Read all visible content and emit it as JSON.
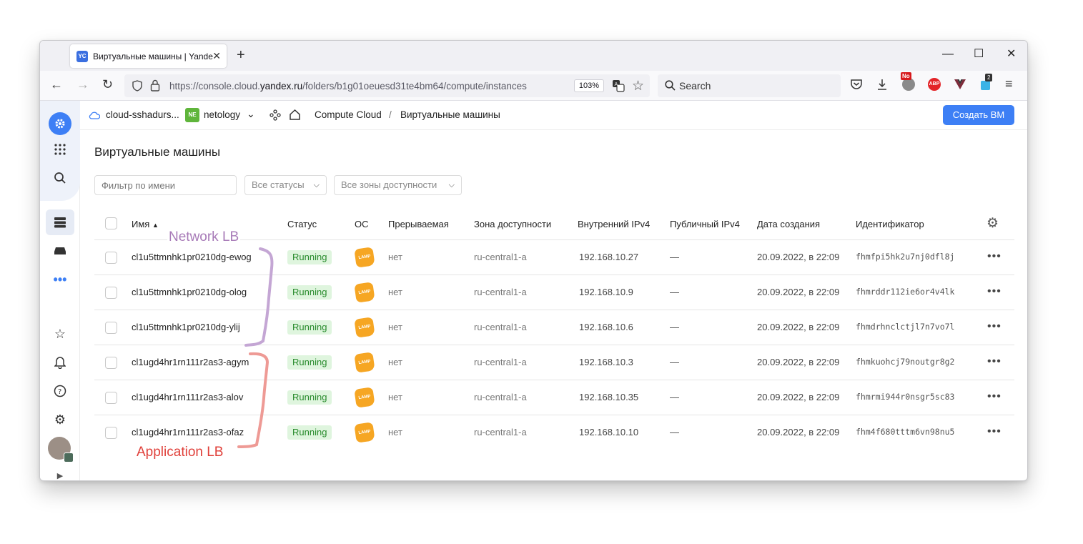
{
  "browser": {
    "tab_favicon": "YC",
    "tab_title": "Виртуальные машины | Yandex",
    "url_prefix": "https://console.cloud.",
    "url_domain": "yandex.ru",
    "url_path": "/folders/b1g01oeuesd31te4bm64/compute/instances",
    "zoom": "103%",
    "search_placeholder": "Search",
    "ext_badge_no": "No",
    "ext_badge_count": "2",
    "ext_abp": "ABP"
  },
  "header": {
    "cloud": "cloud-sshadurs...",
    "folder_badge": "NE",
    "folder": "netology",
    "service": "Compute Cloud",
    "sep": "/",
    "current": "Виртуальные машины",
    "create_button": "Создать ВМ"
  },
  "page": {
    "title": "Виртуальные машины",
    "filter_placeholder": "Фильтр по имени",
    "status_select": "Все статусы",
    "zone_select": "Все зоны доступности"
  },
  "table": {
    "columns": [
      "Имя",
      "Статус",
      "ОС",
      "Прерываемая",
      "Зона доступности",
      "Внутренний IPv4",
      "Публичный IPv4",
      "Дата создания",
      "Идентификатор"
    ],
    "rows": [
      {
        "name": "cl1u5ttmnhk1pr0210dg-ewog",
        "status": "Running",
        "os": "LAMP",
        "preemptible": "нет",
        "zone": "ru-central1-a",
        "ip": "192.168.10.27",
        "public_ip": "—",
        "created": "20.09.2022, в 22:09",
        "id": "fhmfpi5hk2u7nj0dfl8j"
      },
      {
        "name": "cl1u5ttmnhk1pr0210dg-olog",
        "status": "Running",
        "os": "LAMP",
        "preemptible": "нет",
        "zone": "ru-central1-a",
        "ip": "192.168.10.9",
        "public_ip": "—",
        "created": "20.09.2022, в 22:09",
        "id": "fhmrddr112ie6or4v4lk"
      },
      {
        "name": "cl1u5ttmnhk1pr0210dg-ylij",
        "status": "Running",
        "os": "LAMP",
        "preemptible": "нет",
        "zone": "ru-central1-a",
        "ip": "192.168.10.6",
        "public_ip": "—",
        "created": "20.09.2022, в 22:09",
        "id": "fhmdrhnclctjl7n7vo7l"
      },
      {
        "name": "cl1ugd4hr1rn111r2as3-agym",
        "status": "Running",
        "os": "LAMP",
        "preemptible": "нет",
        "zone": "ru-central1-a",
        "ip": "192.168.10.3",
        "public_ip": "—",
        "created": "20.09.2022, в 22:09",
        "id": "fhmkuohcj79noutgr8g2"
      },
      {
        "name": "cl1ugd4hr1rn111r2as3-alov",
        "status": "Running",
        "os": "LAMP",
        "preemptible": "нет",
        "zone": "ru-central1-a",
        "ip": "192.168.10.35",
        "public_ip": "—",
        "created": "20.09.2022, в 22:09",
        "id": "fhmrmi944r0nsgr5sc83"
      },
      {
        "name": "cl1ugd4hr1rn111r2as3-ofaz",
        "status": "Running",
        "os": "LAMP",
        "preemptible": "нет",
        "zone": "ru-central1-a",
        "ip": "192.168.10.10",
        "public_ip": "—",
        "created": "20.09.2022, в 22:09",
        "id": "fhm4f680tttm6vn98nu5"
      }
    ]
  },
  "annotations": {
    "network": {
      "label": "Network LB",
      "color": "#a87bb8"
    },
    "application": {
      "label": "Application LB",
      "color": "#e0403a",
      "bracket_color": "#ee9a95"
    }
  },
  "colors": {
    "accent": "#3d7ff5",
    "running_bg": "#dff5de",
    "running_fg": "#268a2a",
    "lamp": "#f6a623"
  }
}
